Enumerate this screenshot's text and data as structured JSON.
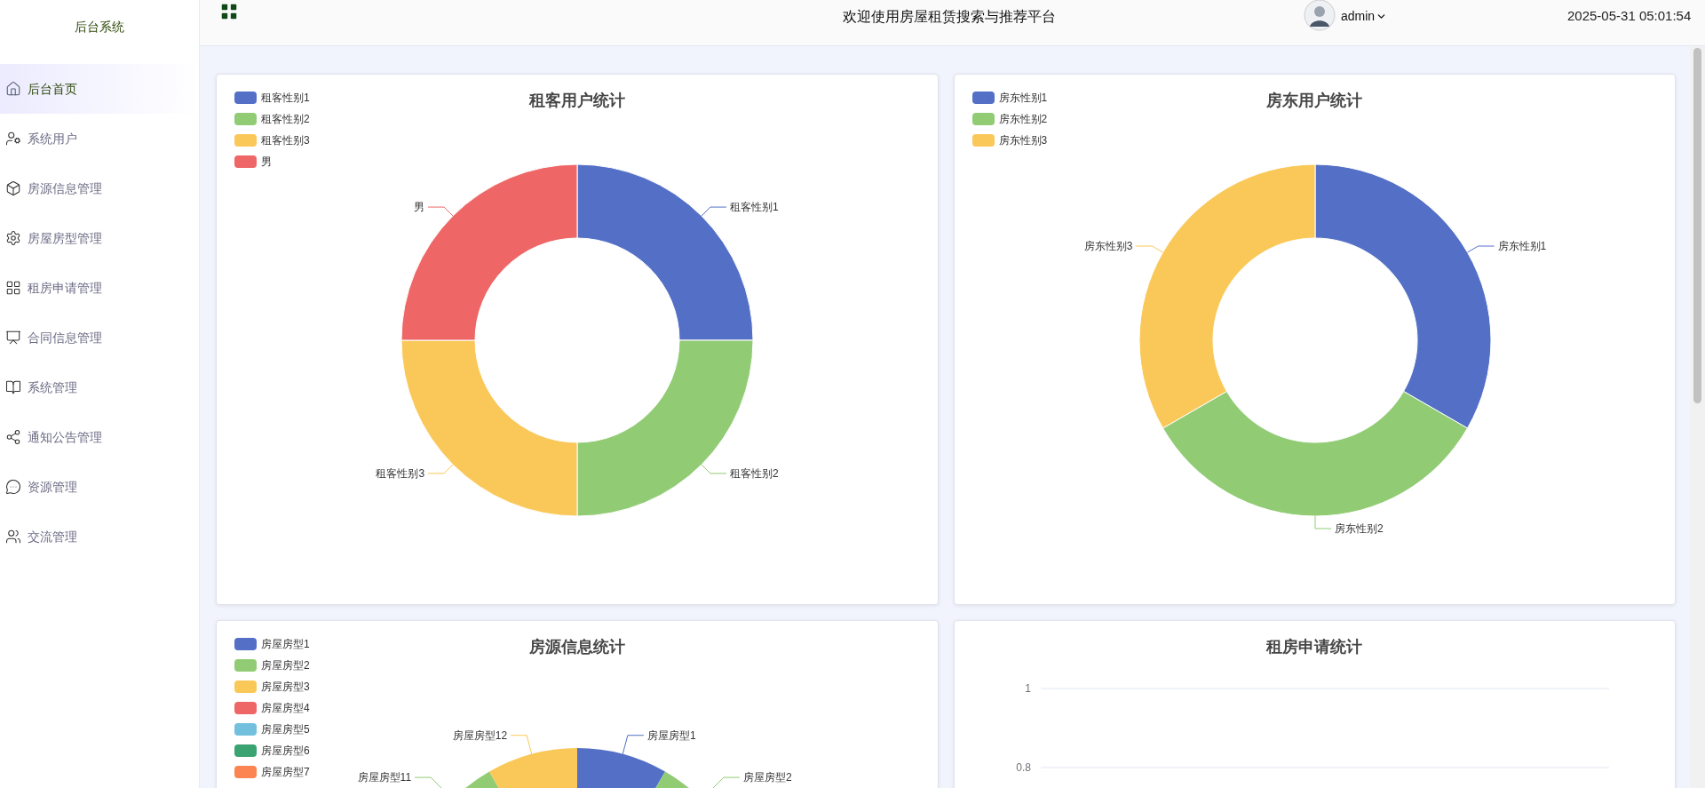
{
  "sidebar": {
    "title": "后台系统",
    "items": [
      {
        "label": "后台首页",
        "selected": true
      },
      {
        "label": "系统用户",
        "selected": false
      },
      {
        "label": "房源信息管理",
        "selected": false
      },
      {
        "label": "房屋房型管理",
        "selected": false
      },
      {
        "label": "租房申请管理",
        "selected": false
      },
      {
        "label": "合同信息管理",
        "selected": false
      },
      {
        "label": "系统管理",
        "selected": false
      },
      {
        "label": "通知公告管理",
        "selected": false
      },
      {
        "label": "资源管理",
        "selected": false
      },
      {
        "label": "交流管理",
        "selected": false
      }
    ]
  },
  "header": {
    "title": "欢迎使用房屋租赁搜索与推荐平台",
    "user": "admin",
    "datetime": "2025-05-31 05:01:54"
  },
  "charts": [
    {
      "title": "租客用户统计",
      "chart_data": {
        "type": "donut",
        "categories": [
          "租客性别1",
          "租客性别2",
          "租客性别3",
          "男"
        ],
        "values": [
          1,
          1,
          1,
          1
        ]
      }
    },
    {
      "title": "房东用户统计",
      "chart_data": {
        "type": "donut",
        "categories": [
          "房东性别1",
          "房东性别2",
          "房东性别3"
        ],
        "values": [
          1,
          1,
          1
        ]
      }
    },
    {
      "title": "房源信息统计",
      "kind": "partial-donut",
      "legend": [
        "房屋房型1",
        "房屋房型2",
        "房屋房型3",
        "房屋房型4",
        "房屋房型5",
        "房屋房型6",
        "房屋房型7"
      ],
      "labels_from_start": [
        "房屋房型1",
        "房屋房型2"
      ],
      "labels_from_end": [
        "房屋房型12",
        "房屋房型11"
      ]
    },
    {
      "title": "租房申请统计",
      "kind": "grid",
      "y_axis_labels": [
        "1",
        "0.8"
      ]
    }
  ]
}
